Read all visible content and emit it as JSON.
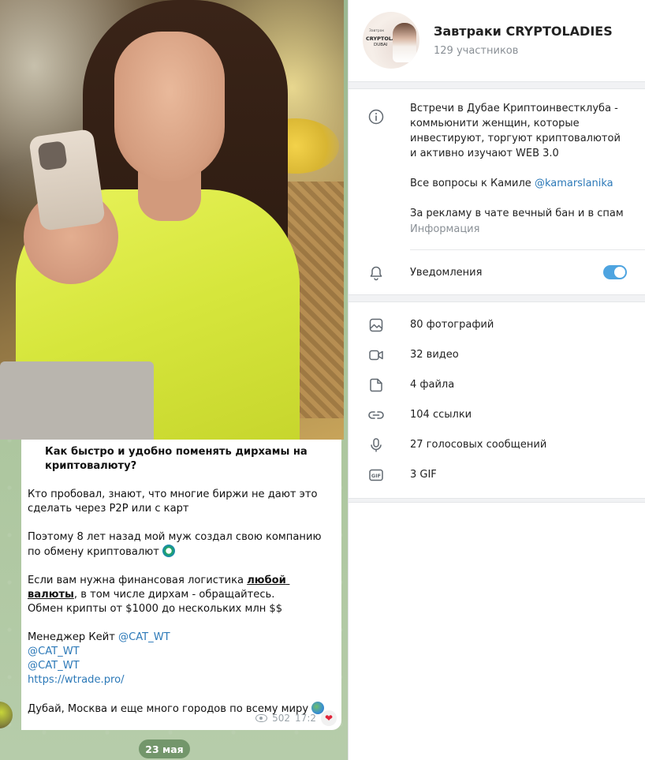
{
  "message": {
    "heading": "Как быстро и удобно поменять дирхамы на криптовалюту?",
    "p1": "Кто пробовал, знают, что многие биржи не дают это сделать через P2P или с карт",
    "p2": "Поэтому 8 лет назад мой муж создал свою компанию по обмену криптовалют",
    "p3_pre": "Если вам нужна финансовая логистика ",
    "p3_bold": "любой валюты",
    "p3_post": ", в том числе дирхам - обращайтесь.",
    "p3_line2": "Обмен крипты от $1000 до нескольких млн $$",
    "manager_label": "Менеджер Кейт ",
    "manager_link": "@CAT_WT",
    "link2": "@CAT_WT",
    "link3": "@CAT_WT",
    "site": "https://wtrade.pro/",
    "footer": "Дубай, Москва и еще много городов по всему миру",
    "views": "502",
    "time": "17:2",
    "reaction": "❤"
  },
  "date_chip": "23 мая",
  "group": {
    "avatar_line1": "Завтрак",
    "avatar_line2": "CRYPTOLADY",
    "avatar_line3": "DUBAI",
    "title": "Завтраки CRYPTOLADIES",
    "members": "129 участников"
  },
  "about": {
    "line1": "Встречи в Дубае Криптоинвестклуба - коммьюнити женщин, которые инвестируют, торгуют криптовалютой и активно изучают WEB 3.0",
    "line2_pre": "Все вопросы к Камиле ",
    "line2_link": "@kamarslanika",
    "line3": "За рекламу в чате вечный бан и в спам",
    "caption": "Информация"
  },
  "notifications": {
    "label": "Уведомления",
    "enabled": true
  },
  "media": [
    {
      "icon": "photo-icon",
      "label": "80 фотографий"
    },
    {
      "icon": "video-icon",
      "label": "32 видео"
    },
    {
      "icon": "file-icon",
      "label": "4 файла"
    },
    {
      "icon": "link-icon",
      "label": "104 ссылки"
    },
    {
      "icon": "mic-icon",
      "label": "27 голосовых сообщений"
    },
    {
      "icon": "gif-icon",
      "label": "3 GIF"
    }
  ],
  "colors": {
    "accent": "#4ea4e0",
    "link": "#2c79b8",
    "muted": "#8a9096",
    "chat_bg": "#a9c49a"
  }
}
